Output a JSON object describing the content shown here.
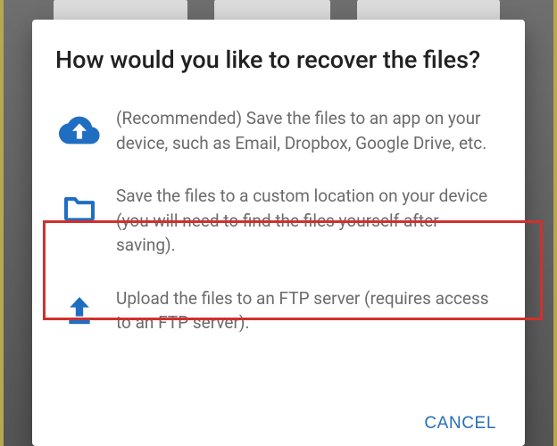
{
  "colors": {
    "accent": "#2670b8",
    "icon_blue": "#1f6ec2",
    "highlight_red": "#d2302c",
    "text_primary": "#212121",
    "text_secondary": "#6b6b6b"
  },
  "dialog": {
    "title": "How would you like to recover the files?",
    "options": [
      {
        "icon": "cloud-upload-icon",
        "text": "(Recommended) Save the files to an app on your device, such as Email, Dropbox, Google Drive, etc."
      },
      {
        "icon": "folder-icon",
        "text": "Save the files to a custom location on your device (you will need to find the files yourself after saving).",
        "highlighted": true
      },
      {
        "icon": "ftp-upload-icon",
        "text": "Upload the files to an FTP server (requires access to an FTP server)."
      }
    ],
    "cancel_label": "CANCEL"
  }
}
